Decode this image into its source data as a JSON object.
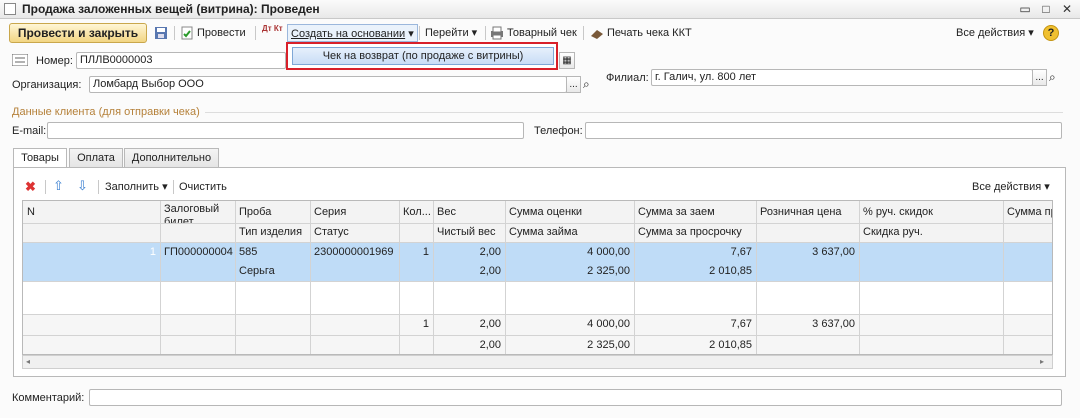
{
  "window": {
    "title": "Продажа заложенных вещей (витрина): Проведен"
  },
  "toolbar": {
    "post_close": "Провести и закрыть",
    "post": "Провести",
    "dtkt": "Дт Кт",
    "create_based": "Создать на основании",
    "goto": "Перейти",
    "goods_receipt": "Товарный чек",
    "print_kkt": "Печать чека ККТ",
    "all_actions": "Все действия"
  },
  "dropdown": {
    "item": "Чек на возврат (по продаже с витрины)"
  },
  "form": {
    "number_label": "Номер:",
    "number_value": "ПЛЛВ0000003",
    "org_label": "Организация:",
    "org_value": "Ломбард Выбор ООО",
    "branch_label": "Филиал:",
    "branch_value": "г. Галич, ул. 800 лет",
    "client_section": "Данные клиента (для отправки чека)",
    "email_label": "E-mail:",
    "email_value": "",
    "phone_label": "Телефон:",
    "phone_value": "",
    "comment_label": "Комментарий:",
    "comment_value": ""
  },
  "tabs": [
    "Товары",
    "Оплата",
    "Дополнительно"
  ],
  "table_toolbar": {
    "fill": "Заполнить",
    "clear": "Очистить",
    "all_actions": "Все действия"
  },
  "table": {
    "header1": [
      "N",
      "Залоговый билет",
      "Проба",
      "Серия",
      "Кол...",
      "Вес",
      "Сумма оценки",
      "Сумма за заем",
      "Розничная цена",
      "% руч. скидок",
      "Сумма пр"
    ],
    "header2": [
      "",
      "",
      "Тип изделия",
      "Статус",
      "",
      "Чистый вес",
      "Сумма займа",
      "Сумма за просрочку",
      "",
      "Скидка руч.",
      ""
    ],
    "row1": [
      "1",
      "ГП000000004",
      "585",
      "2300000001969",
      "1",
      "2,00",
      "4 000,00",
      "7,67",
      "3 637,00",
      "",
      ""
    ],
    "row2": [
      "",
      "",
      "Серьга",
      "",
      "",
      "2,00",
      "2 325,00",
      "2 010,85",
      "",
      "",
      ""
    ],
    "total1": [
      "",
      "",
      "",
      "",
      "1",
      "2,00",
      "4 000,00",
      "7,67",
      "3 637,00",
      "",
      ""
    ],
    "total2": [
      "",
      "",
      "",
      "",
      "",
      "2,00",
      "2 325,00",
      "2 010,85",
      "",
      "",
      ""
    ]
  },
  "colors": {
    "selected_row": "#bfdcf7",
    "selected_key": "#6f9fd5",
    "accent_red": "#d8202a",
    "primary_button": "#f2d583"
  }
}
